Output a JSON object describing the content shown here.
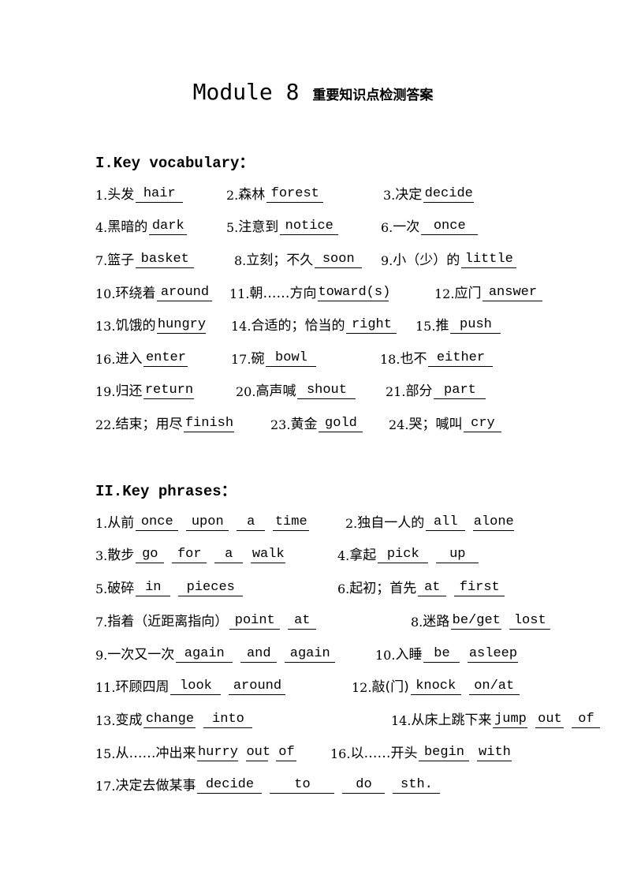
{
  "title": {
    "en": "Module 8 ",
    "cn": "重要知识点检测答案"
  },
  "section1": {
    "heading": "I.Key vocabulary：",
    "items": [
      {
        "n": "1.",
        "cn": "头发",
        "ans": [
          "hair"
        ]
      },
      {
        "n": "2.",
        "cn": "森林",
        "ans": [
          "forest"
        ]
      },
      {
        "n": "3.",
        "cn": "决定",
        "ans": [
          "decide"
        ]
      },
      {
        "n": "4.",
        "cn": "黑暗的",
        "ans": [
          "dark"
        ]
      },
      {
        "n": "5.",
        "cn": "注意到",
        "ans": [
          "notice"
        ]
      },
      {
        "n": "6.",
        "cn": "一次",
        "ans": [
          "once"
        ]
      },
      {
        "n": "7.",
        "cn": "篮子",
        "ans": [
          "basket"
        ]
      },
      {
        "n": "8.",
        "cn": "立刻；不久",
        "ans": [
          "soon"
        ]
      },
      {
        "n": "9.",
        "cn": "小（少）的",
        "ans": [
          "little"
        ]
      },
      {
        "n": "10.",
        "cn": "环绕着",
        "ans": [
          "around"
        ]
      },
      {
        "n": "11.",
        "cn": "朝……方向",
        "ans": [
          "toward(s)"
        ]
      },
      {
        "n": "12.",
        "cn": "应门",
        "ans": [
          "answer"
        ]
      },
      {
        "n": "13.",
        "cn": "饥饿的",
        "ans": [
          "hungry"
        ]
      },
      {
        "n": "14.",
        "cn": "合适的；恰当的",
        "ans": [
          "right"
        ]
      },
      {
        "n": "15.",
        "cn": "推",
        "ans": [
          "push"
        ]
      },
      {
        "n": "16.",
        "cn": "进入",
        "ans": [
          "enter"
        ]
      },
      {
        "n": "17.",
        "cn": "碗",
        "ans": [
          "bowl"
        ]
      },
      {
        "n": "18.",
        "cn": "也不",
        "ans": [
          "either"
        ]
      },
      {
        "n": "19.",
        "cn": "归还",
        "ans": [
          "return"
        ]
      },
      {
        "n": "20.",
        "cn": "高声喊",
        "ans": [
          "shout"
        ]
      },
      {
        "n": "21.",
        "cn": "部分",
        "ans": [
          "part"
        ]
      },
      {
        "n": "22.",
        "cn": "结束；用尽",
        "ans": [
          "finish"
        ]
      },
      {
        "n": "23.",
        "cn": "黄金",
        "ans": [
          "gold"
        ]
      },
      {
        "n": "24.",
        "cn": "哭；喊叫",
        "ans": [
          "cry"
        ]
      }
    ]
  },
  "section2": {
    "heading": "II.Key phrases：",
    "items": [
      {
        "n": "1.",
        "cn": "从前",
        "ans": [
          "once",
          "upon",
          "a",
          "time"
        ]
      },
      {
        "n": "2.",
        "cn": "独自一人的",
        "ans": [
          "all",
          "alone"
        ]
      },
      {
        "n": "3.",
        "cn": "散步",
        "ans": [
          "go",
          "for",
          "a",
          "walk"
        ]
      },
      {
        "n": "4.",
        "cn": "拿起",
        "ans": [
          "pick",
          "up"
        ]
      },
      {
        "n": "5.",
        "cn": "破碎",
        "ans": [
          "in",
          "pieces"
        ]
      },
      {
        "n": "6.",
        "cn": "起初；首先",
        "ans": [
          "at",
          "first"
        ]
      },
      {
        "n": "7.",
        "cn": "指着（近距离指向）",
        "ans": [
          "point",
          "at"
        ]
      },
      {
        "n": "8.",
        "cn": "迷路",
        "ans": [
          "be/get",
          "lost"
        ]
      },
      {
        "n": "9.",
        "cn": "一次又一次",
        "ans": [
          "again",
          "and",
          "again"
        ]
      },
      {
        "n": "10.",
        "cn": "入睡",
        "ans": [
          "be",
          "asleep"
        ]
      },
      {
        "n": "11.",
        "cn": "环顾四周",
        "ans": [
          "look",
          "around"
        ]
      },
      {
        "n": "12.",
        "cn": "敲(门)",
        "ans": [
          "knock",
          "on/at"
        ]
      },
      {
        "n": "13.",
        "cn": "变成",
        "ans": [
          "change",
          "into"
        ]
      },
      {
        "n": "14.",
        "cn": "从床上跳下来",
        "ans": [
          "jump",
          "out",
          "of"
        ]
      },
      {
        "n": "15.",
        "cn": "从……冲出来",
        "ans": [
          "hurry",
          "out",
          "of"
        ]
      },
      {
        "n": "16.",
        "cn": "以……开头",
        "ans": [
          "begin",
          "with"
        ]
      },
      {
        "n": "17.",
        "cn": "决定去做某事",
        "ans": [
          "decide",
          "to",
          "do",
          "sth."
        ]
      }
    ]
  }
}
